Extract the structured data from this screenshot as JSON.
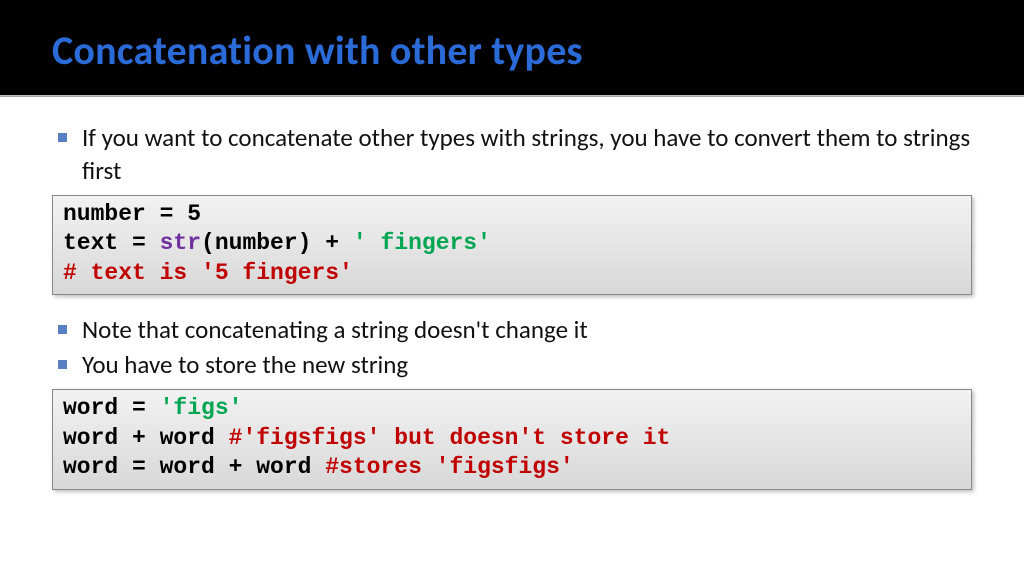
{
  "title": "Concatenation with other types",
  "bullets1": [
    "If you want to concatenate other types with strings, you have to convert them to strings first"
  ],
  "code1": {
    "l1": {
      "a": "number = 5"
    },
    "l2": {
      "a": "text = ",
      "b": "str",
      "c": "(number) + ",
      "d": "' fingers'"
    },
    "l3": {
      "a": "# text is '5 fingers'"
    }
  },
  "bullets2": [
    "Note that concatenating a string doesn't change it",
    "You have to store the new string"
  ],
  "code2": {
    "l1": {
      "a": "word = ",
      "b": "'figs'"
    },
    "l2": {
      "a": "word + word ",
      "b": "#'figsfigs' but doesn't store it"
    },
    "l3": {
      "a": "word = word + word ",
      "b": "#stores 'figsfigs'"
    }
  }
}
